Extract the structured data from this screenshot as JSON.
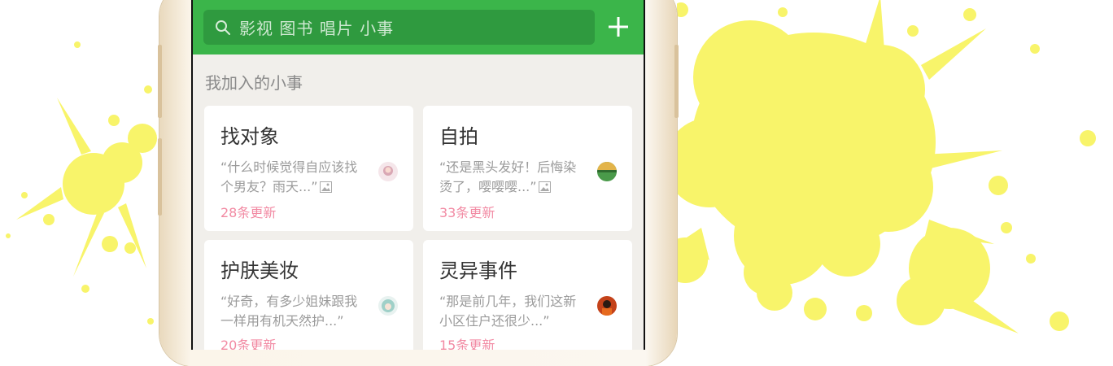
{
  "search": {
    "placeholder": "影视 图书 唱片 小事"
  },
  "section": {
    "title": "我加入的小事"
  },
  "cards": [
    {
      "title": "找对象",
      "excerpt": "“什么时候觉得自应该找个男友？雨天...”",
      "count": "28条更新"
    },
    {
      "title": "自拍",
      "excerpt": "“还是黑头发好！后悔染烫了，嘤嘤嘤...”",
      "count": "33条更新"
    },
    {
      "title": "护肤美妆",
      "excerpt": "“好奇，有多少姐妹跟我一样用有机天然护...”",
      "count": "20条更新"
    },
    {
      "title": "灵异事件",
      "excerpt": "“那是前几年，我们这新小区住户还很少...”",
      "count": "15条更新"
    }
  ],
  "colors": {
    "accent": "#3bb54a",
    "search_bg": "#2f9a3f",
    "count": "#f28aa3",
    "splash": "#f8f46a"
  },
  "icons": [
    "search-icon",
    "plus-icon",
    "image-icon",
    "avatar"
  ]
}
